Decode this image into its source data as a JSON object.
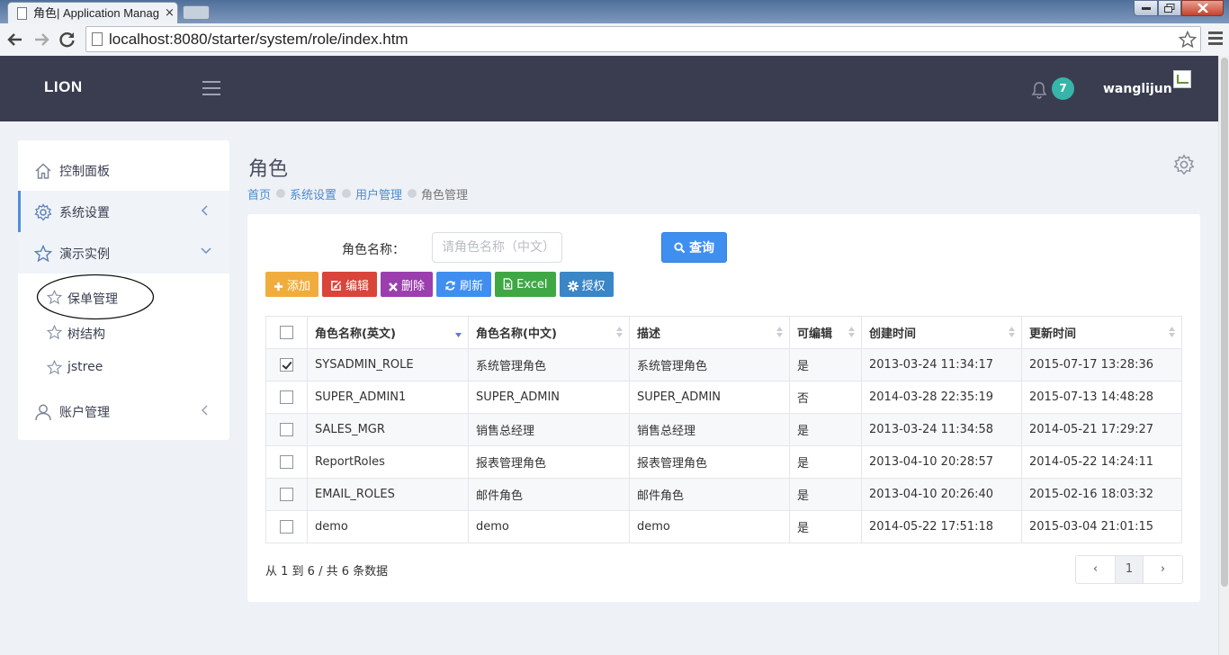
{
  "browser": {
    "tab_title": "角色| Application Manag",
    "tab_close": "×",
    "url": "localhost:8080/starter/system/role/index.htm"
  },
  "header": {
    "logo": "LION",
    "notification_count": "7",
    "username": "wanglijun",
    "bg_color": "#3a3d50",
    "badge_color": "#36b5a8"
  },
  "sidebar": {
    "items": [
      {
        "label": "控制面板",
        "icon": "home-icon"
      },
      {
        "label": "系统设置",
        "icon": "gear-icon",
        "chevron": "chevron-left-icon",
        "active": true
      },
      {
        "label": "演示实例",
        "icon": "star-icon",
        "chevron": "chevron-down-icon",
        "expanded": true
      },
      {
        "label": "账户管理",
        "icon": "user-icon",
        "chevron": "chevron-left-icon"
      }
    ],
    "sub_items": [
      {
        "label": "保单管理",
        "icon": "star-outline-icon",
        "circled": true
      },
      {
        "label": "树结构",
        "icon": "star-outline-icon"
      },
      {
        "label": "jstree",
        "icon": "star-outline-icon"
      }
    ],
    "active_color": "#4f8fd8"
  },
  "page": {
    "title": "角色",
    "breadcrumb": [
      "首页",
      "系统设置",
      "用户管理",
      "角色管理"
    ]
  },
  "search": {
    "label": "角色名称：",
    "placeholder": "请角色名称（中文）",
    "value": "",
    "button_label": "查询",
    "button_color": "#3f8ff0"
  },
  "actions": [
    {
      "label": "添加",
      "icon": "plus-icon",
      "color": "#f0ad3e"
    },
    {
      "label": "编辑",
      "icon": "edit-icon",
      "color": "#d9443b"
    },
    {
      "label": "删除",
      "icon": "times-icon",
      "color": "#9b3fae"
    },
    {
      "label": "刷新",
      "icon": "refresh-icon",
      "color": "#3f8ff0"
    },
    {
      "label": "Excel",
      "icon": "file-excel-icon",
      "color": "#3fa845"
    },
    {
      "label": "授权",
      "icon": "cog-icon",
      "color": "#3a86c6"
    }
  ],
  "table": {
    "columns": [
      "角色名称(英文)",
      "角色名称(中文)",
      "描述",
      "可编辑",
      "创建时间",
      "更新时间"
    ],
    "sorted_column": 0,
    "sort_direction": "desc",
    "rows": [
      {
        "checked": true,
        "cells": [
          "SYSADMIN_ROLE",
          "系统管理角色",
          "系统管理角色",
          "是",
          "2013-03-24 11:34:17",
          "2015-07-17 13:28:36"
        ]
      },
      {
        "checked": false,
        "cells": [
          "SUPER_ADMIN1",
          "SUPER_ADMIN",
          "SUPER_ADMIN",
          "否",
          "2014-03-28 22:35:19",
          "2015-07-13 14:48:28"
        ]
      },
      {
        "checked": false,
        "cells": [
          "SALES_MGR",
          "销售总经理",
          "销售总经理",
          "是",
          "2013-03-24 11:34:58",
          "2014-05-21 17:29:27"
        ]
      },
      {
        "checked": false,
        "cells": [
          "ReportRoles",
          "报表管理角色",
          "报表管理角色",
          "是",
          "2013-04-10 20:28:57",
          "2014-05-22 14:24:11"
        ]
      },
      {
        "checked": false,
        "cells": [
          "EMAIL_ROLES",
          "邮件角色",
          "邮件角色",
          "是",
          "2013-04-10 20:26:40",
          "2015-02-16 18:03:32"
        ]
      },
      {
        "checked": false,
        "cells": [
          "demo",
          "demo",
          "demo",
          "是",
          "2014-05-22 17:51:18",
          "2015-03-04 21:01:15"
        ]
      }
    ],
    "info": "从 1 到 6 / 共 6 条数据"
  },
  "pagination": {
    "prev": "‹",
    "current": "1",
    "next": "›"
  }
}
